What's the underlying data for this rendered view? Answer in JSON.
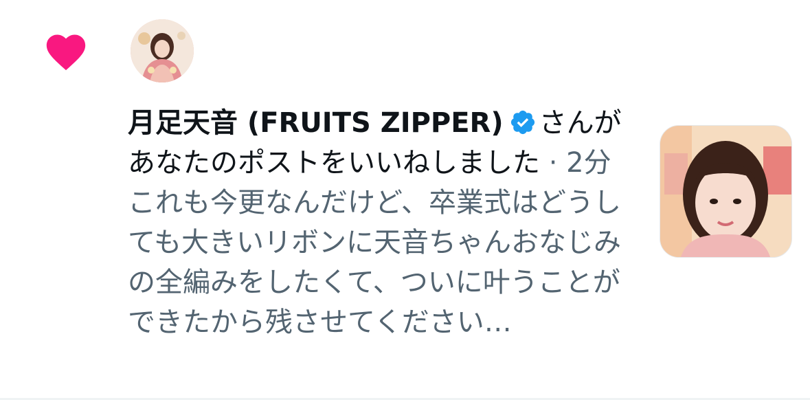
{
  "notification": {
    "type_icon": "heart-icon",
    "accent_color": "#f91880",
    "verified_color": "#1d9bf0",
    "user_name": "月足天音 (FRUITS ZIPPER)",
    "action_text_part1": "さんが",
    "action_text_part2": "あなたのポストをいいねしました",
    "separator": " · ",
    "timestamp": "2分",
    "post_excerpt": "これも今更なんだけど、卒業式はどうしても大きいリボンに天音ちゃんおなじみの全編みをしたくて、ついに叶うことができたから残させてください…"
  }
}
